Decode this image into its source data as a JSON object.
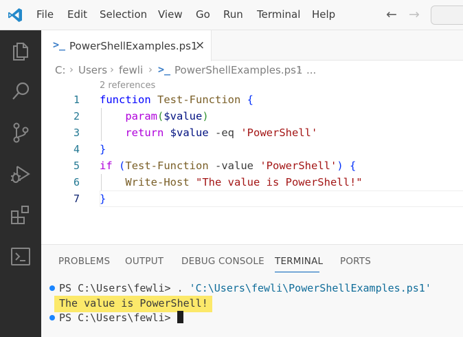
{
  "menu": {
    "items": [
      "File",
      "Edit",
      "Selection",
      "View",
      "Go",
      "Run",
      "Terminal",
      "Help"
    ]
  },
  "icons": {
    "app": "vscode-logo-icon",
    "back": "arrow-left-icon",
    "forward": "arrow-right-icon",
    "activity": [
      "explorer-icon",
      "search-icon",
      "source-control-icon",
      "run-debug-icon",
      "extensions-icon",
      "terminal-icon"
    ],
    "tab_file": "powershell-file-icon",
    "tab_close": "close-icon",
    "terminal_status": "circle-icon"
  },
  "tab": {
    "label": "PowerShellExamples.ps1",
    "close": "×"
  },
  "breadcrumb": {
    "parts": [
      "C:",
      "Users",
      "fewli",
      "PowerShellExamples.ps1",
      "..."
    ],
    "separator": "›"
  },
  "editor": {
    "codelens": "2 references",
    "line_numbers": [
      "1",
      "2",
      "3",
      "4",
      "5",
      "6",
      "7"
    ],
    "current_line": 7,
    "lines": [
      [
        {
          "t": "function",
          "c": "kw"
        },
        {
          "t": " ",
          "c": "op"
        },
        {
          "t": "Test-Function",
          "c": "fn"
        },
        {
          "t": " ",
          "c": "op"
        },
        {
          "t": "{",
          "c": "br"
        }
      ],
      [
        {
          "t": "    ",
          "c": "op"
        },
        {
          "t": "param",
          "c": "kw2"
        },
        {
          "t": "(",
          "c": "br2"
        },
        {
          "t": "$value",
          "c": "var"
        },
        {
          "t": ")",
          "c": "br2"
        }
      ],
      [
        {
          "t": "    ",
          "c": "op"
        },
        {
          "t": "return",
          "c": "kw2"
        },
        {
          "t": " ",
          "c": "op"
        },
        {
          "t": "$value",
          "c": "var"
        },
        {
          "t": " -eq ",
          "c": "op"
        },
        {
          "t": "'PowerShell'",
          "c": "str"
        }
      ],
      [
        {
          "t": "}",
          "c": "br"
        }
      ],
      [
        {
          "t": "if",
          "c": "kw2"
        },
        {
          "t": " ",
          "c": "op"
        },
        {
          "t": "(",
          "c": "br"
        },
        {
          "t": "Test-Function",
          "c": "fn"
        },
        {
          "t": " -value ",
          "c": "op"
        },
        {
          "t": "'PowerShell'",
          "c": "str"
        },
        {
          "t": ")",
          "c": "br"
        },
        {
          "t": " ",
          "c": "op"
        },
        {
          "t": "{",
          "c": "br"
        }
      ],
      [
        {
          "t": "    ",
          "c": "op"
        },
        {
          "t": "Write-Host",
          "c": "fn"
        },
        {
          "t": " ",
          "c": "op"
        },
        {
          "t": "\"The value is PowerShell!\"",
          "c": "str"
        }
      ],
      [
        {
          "t": "}",
          "c": "br"
        }
      ]
    ]
  },
  "panel": {
    "tabs": [
      "PROBLEMS",
      "OUTPUT",
      "DEBUG CONSOLE",
      "TERMINAL",
      "PORTS"
    ],
    "active_tab": "TERMINAL",
    "terminal": {
      "line1_prompt": "PS C:\\Users\\fewli> . ",
      "line1_path": "'C:\\Users\\fewli\\PowerShellExamples.ps1'",
      "line2_output": "The value is PowerShell!",
      "line3_prompt": "PS C:\\Users\\fewli> "
    }
  },
  "colors": {
    "activity_bar": "#2c2c2c",
    "accent": "#005fb8",
    "highlight": "#fce96a",
    "keyword": "#0000ff",
    "control_keyword": "#af00db",
    "function": "#795e26",
    "variable": "#001080",
    "string": "#a31515",
    "line_number": "#237893"
  }
}
